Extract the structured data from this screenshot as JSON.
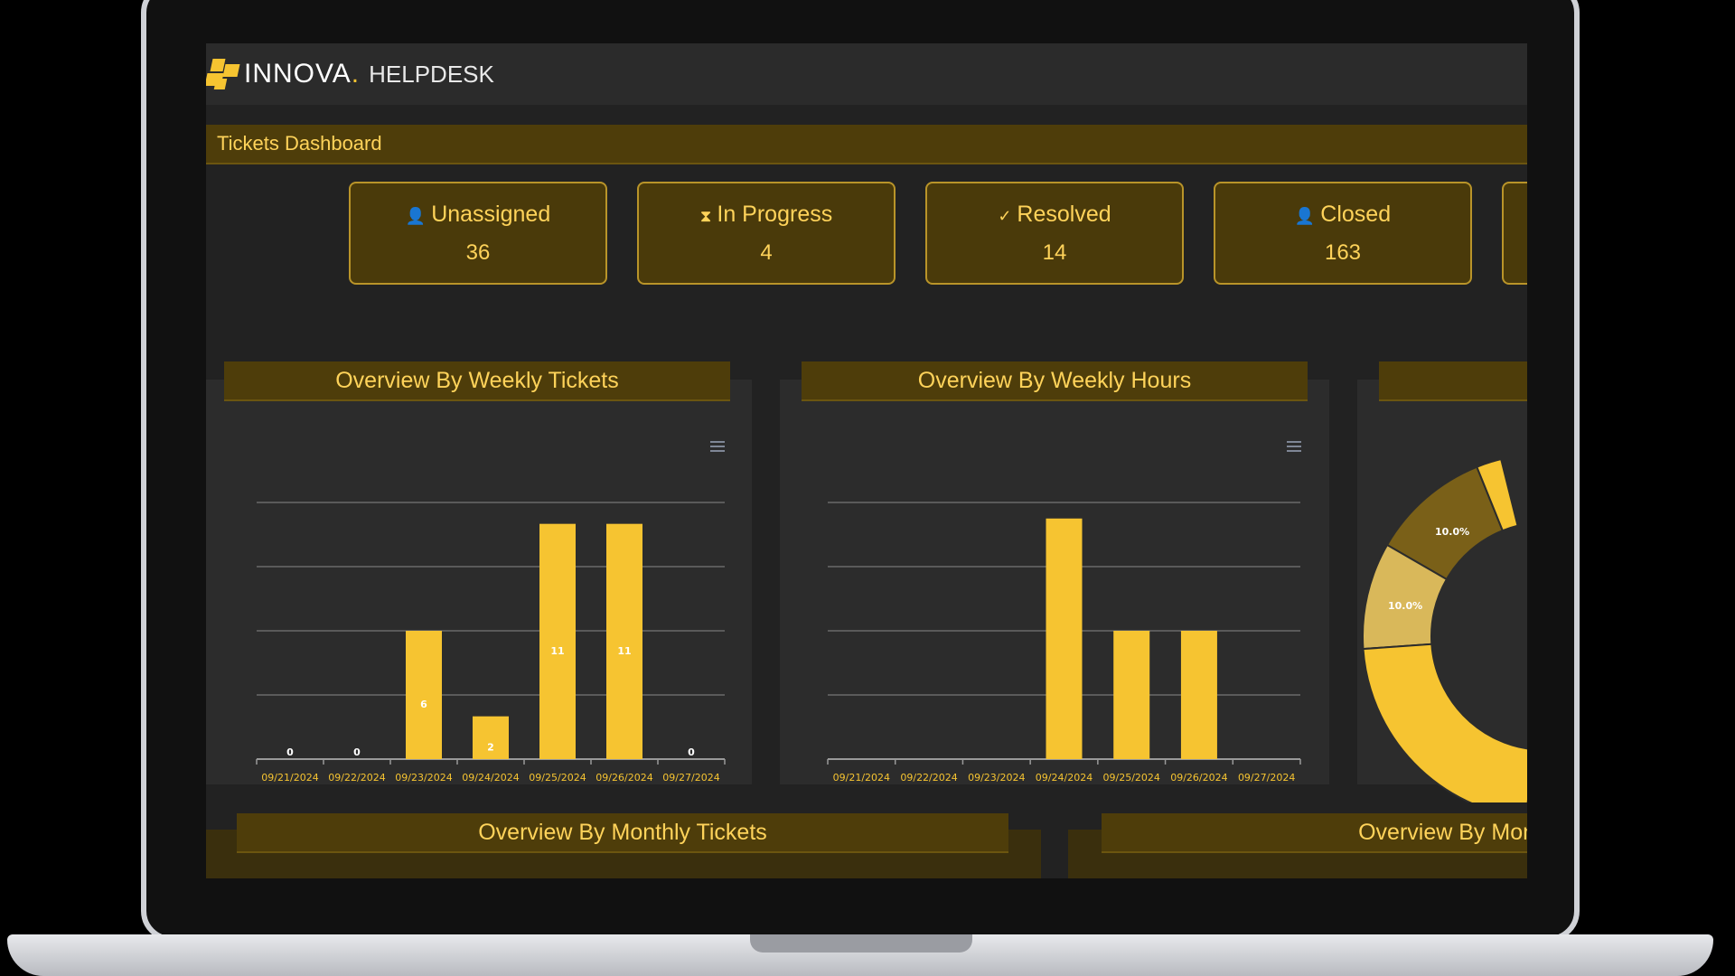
{
  "app": {
    "logo_text": "INNOVA",
    "logo_dot": ".",
    "logo_sub": "HELPDESK"
  },
  "dashboard": {
    "title": "Tickets Dashboard"
  },
  "stats": [
    {
      "icon": "user-x-icon",
      "glyph": "👤",
      "label": "Unassigned",
      "value": "36"
    },
    {
      "icon": "hourglass-icon",
      "glyph": "⧗",
      "label": "In Progress",
      "value": "4"
    },
    {
      "icon": "check-circle-icon",
      "glyph": "✓",
      "label": "Resolved",
      "value": "14"
    },
    {
      "icon": "user-x-icon",
      "glyph": "👤",
      "label": "Closed",
      "value": "163"
    }
  ],
  "panels": {
    "weekly_tickets": "Overview By Weekly Tickets",
    "weekly_hours": "Overview By Weekly Hours",
    "monthly_tickets": "Overview By Monthly Tickets",
    "monthly_partial": "Overview By Mon"
  },
  "colors": {
    "accent": "#f6c431",
    "header_bg": "#4e3d0a",
    "card_border": "#b99429",
    "text_accent": "#ffd35a"
  },
  "chart_data": [
    {
      "type": "bar",
      "categories": [
        "09/21/2024",
        "09/22/2024",
        "09/23/2024",
        "09/24/2024",
        "09/25/2024",
        "09/26/2024",
        "09/27/2024"
      ],
      "values": [
        0,
        0,
        6,
        2,
        11,
        11,
        0
      ],
      "labels": [
        "0",
        "0",
        "6",
        "2",
        "11",
        "11",
        "0"
      ],
      "ylim": [
        0,
        12
      ],
      "grid": true
    },
    {
      "type": "bar",
      "categories": [
        "09/21/2024",
        "09/22/2024",
        "09/23/2024",
        "09/24/2024",
        "09/25/2024",
        "09/26/2024",
        "09/27/2024"
      ],
      "values": [
        0,
        0,
        0,
        7.5,
        4,
        4,
        0
      ],
      "ylim": [
        0,
        8
      ],
      "grid": true
    },
    {
      "type": "pie",
      "slices": [
        {
          "label": "10.0%",
          "value": 10,
          "color": "#7a6018"
        },
        {
          "label": "10.0%",
          "value": 10,
          "color": "#d9b85a"
        }
      ]
    }
  ]
}
